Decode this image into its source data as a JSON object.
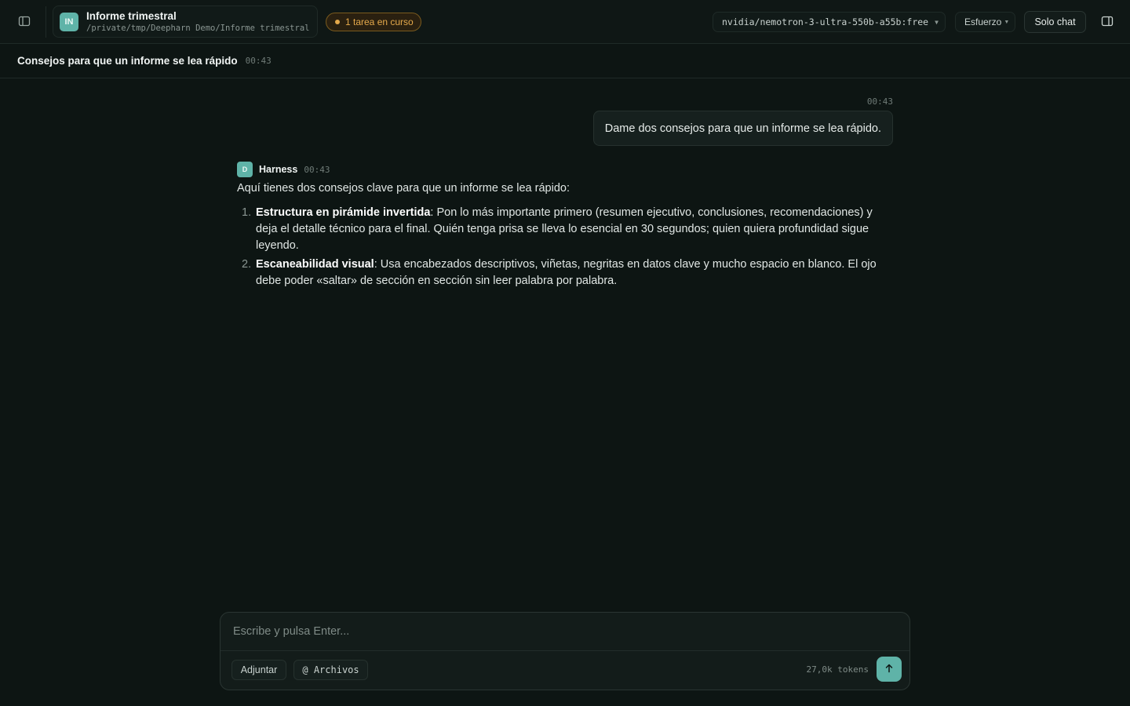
{
  "topbar": {
    "sidebar_toggle_icon": "sidebar-icon",
    "project": {
      "initials": "IN",
      "name": "Informe trimestral",
      "path": "/private/tmp/Deepharn Demo/Informe trimestral"
    },
    "task_badge": "1 tarea en curso",
    "model": "nvidia/nemotron-3-ultra-550b-a55b:free",
    "effort": "Esfuerzo",
    "chat_only_label": "Solo chat",
    "panel_toggle_icon": "panel-right-icon"
  },
  "conversation": {
    "title": "Consejos para que un informe se lea rápido",
    "time": "00:43"
  },
  "messages": {
    "user": {
      "time": "00:43",
      "text": "Dame dos consejos para que un informe se lea rápido."
    },
    "assistant": {
      "avatar": "D",
      "name": "Harness",
      "time": "00:43",
      "intro": "Aquí tienes dos consejos clave para que un informe se lea rápido:",
      "tips": [
        {
          "num": "1.",
          "title": "Estructura en pirámide invertida",
          "text": ": Pon lo más importante primero (resumen ejecutivo, conclusiones, recomendaciones) y deja el detalle técnico para el final. Quién tenga prisa se lleva lo esencial en 30 segundos; quien quiera profundidad sigue leyendo."
        },
        {
          "num": "2.",
          "title": "Escaneabilidad visual",
          "text": ": Usa encabezados descriptivos, viñetas, negritas en datos clave y mucho espacio en blanco. El ojo debe poder «saltar» de sección en sección sin leer palabra por palabra."
        }
      ]
    }
  },
  "composer": {
    "placeholder": "Escribe y pulsa Enter...",
    "attach_label": "Adjuntar",
    "files_label": "@ Archivos",
    "tokens": "27,0k tokens",
    "send_icon": "arrow-up-icon"
  },
  "colors": {
    "background": "#0d1513",
    "accent": "#5fb3a8",
    "warning": "#e5a94b"
  }
}
